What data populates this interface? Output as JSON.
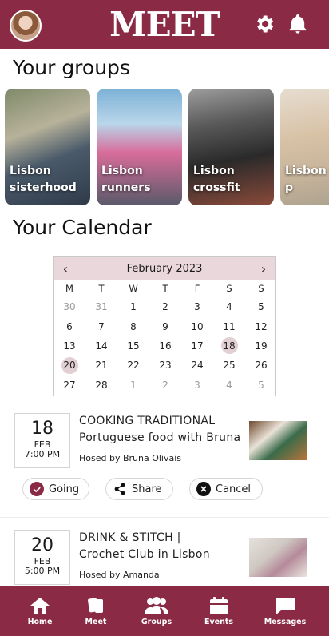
{
  "app": {
    "logo": "MEET"
  },
  "header": {
    "icons": [
      "gear-icon",
      "bell-icon"
    ]
  },
  "groups": {
    "title": "Your groups",
    "items": [
      {
        "label": "Lisbon sisterhood"
      },
      {
        "label": "Lisbon runners"
      },
      {
        "label": "Lisbon crossfit"
      },
      {
        "label": "Lisbon coffee p"
      }
    ]
  },
  "calendar": {
    "title": "Your Calendar",
    "month": "February 2023",
    "weekdays": [
      "M",
      "T",
      "W",
      "T",
      "F",
      "S",
      "S"
    ],
    "weeks": [
      [
        "30",
        "31",
        "1",
        "2",
        "3",
        "4",
        "5"
      ],
      [
        "6",
        "7",
        "8",
        "9",
        "10",
        "11",
        "12"
      ],
      [
        "13",
        "14",
        "15",
        "16",
        "17",
        "18",
        "19"
      ],
      [
        "20",
        "21",
        "22",
        "23",
        "24",
        "25",
        "26"
      ],
      [
        "27",
        "28",
        "1",
        "2",
        "3",
        "4",
        "5"
      ]
    ],
    "highlighted": [
      "18",
      "20"
    ]
  },
  "events": [
    {
      "day": "18",
      "month": "FEB",
      "time": "7:00 PM",
      "title_line1": "COOKING TRADITIONAL",
      "title_line2": "Portuguese food with Bruna",
      "host": "Hosed by Bruna Olivais"
    },
    {
      "day": "20",
      "month": "FEB",
      "time": "5:00 PM",
      "title_line1": "DRINK & STITCH |",
      "title_line2": "Crochet Club in Lisbon",
      "host": "Hosed by Amanda"
    }
  ],
  "actions": {
    "going": "Going",
    "share": "Share",
    "cancel": "Cancel"
  },
  "nav": [
    {
      "label": "Home"
    },
    {
      "label": "Meet"
    },
    {
      "label": "Groups"
    },
    {
      "label": "Events"
    },
    {
      "label": "Messages"
    }
  ],
  "colors": {
    "brand": "#8a2a45",
    "highlight": "#e2cfd4",
    "calendar_header": "#ead7dc"
  }
}
